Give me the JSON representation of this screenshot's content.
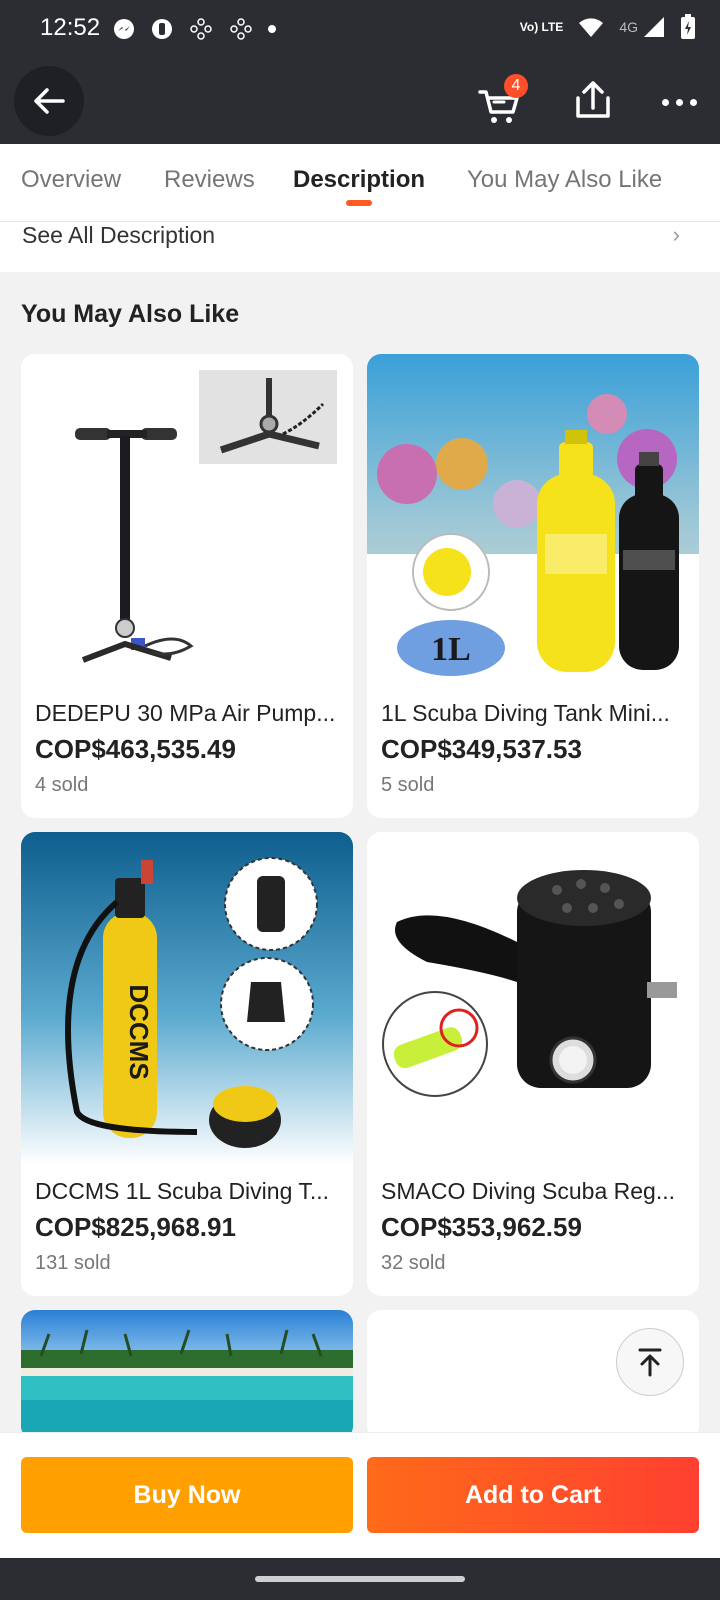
{
  "status_bar": {
    "time": "12:52",
    "network": "4G",
    "lte_label": "Vo) LTE"
  },
  "header": {
    "cart_count": "4"
  },
  "tabs": [
    {
      "label": "Overview"
    },
    {
      "label": "Reviews"
    },
    {
      "label": "Description",
      "active": true
    },
    {
      "label": "You May Also Like"
    }
  ],
  "description": {
    "see_all": "See All Description",
    "chevron": "›"
  },
  "section": {
    "title": "You May Also Like"
  },
  "products": [
    {
      "title": "DEDEPU 30 MPa Air Pump...",
      "price": "COP$463,535.49",
      "sold": "4 sold"
    },
    {
      "title": "1L Scuba Diving Tank Mini...",
      "price": "COP$349,537.53",
      "sold": "5 sold",
      "image_text": "1L"
    },
    {
      "title": "DCCMS 1L Scuba Diving T...",
      "price": "COP$825,968.91",
      "sold": "131 sold",
      "image_text": "DCCMS"
    },
    {
      "title": "SMACO Diving Scuba Reg...",
      "price": "COP$353,962.59",
      "sold": "32 sold"
    }
  ],
  "actions": {
    "buy_now": "Buy Now",
    "add_to_cart": "Add to Cart"
  },
  "colors": {
    "accent": "#ff5a1f",
    "buy": "#ffa000",
    "cart": "#ff4a2a",
    "dark": "#2c2d33"
  }
}
